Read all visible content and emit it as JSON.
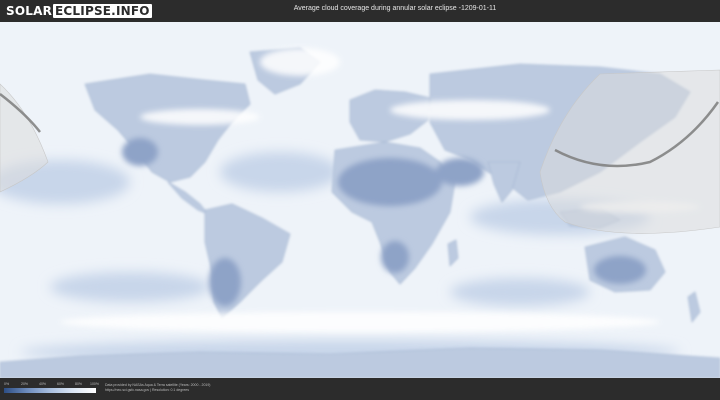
{
  "header": {
    "logo_part1": "SOLAR",
    "logo_part2": "ECLIPSE.INFO",
    "title": "Average cloud coverage during annular solar eclipse -1209-01-11"
  },
  "legend": {
    "ticks": [
      "0%",
      "20%",
      "40%",
      "60%",
      "80%",
      "100%"
    ],
    "colors": [
      "#2d4e84",
      "#6d8cbd",
      "#a9bfdf",
      "#dbe6f4",
      "#ffffff"
    ]
  },
  "credits": {
    "line1": "Data provided by NASAs Aqua & Terra satellite (Years: 2000 - 2019)",
    "line2": "https://neo.sci.gsfc.nasa.gov | Resolution: 0.1 degrees"
  },
  "map": {
    "land_color": "#bccae0",
    "cloud_color": "#f3f6fb",
    "eclipse_path_color": "#7c7c7c",
    "visibility_overlay_color": "#dcdcdc"
  }
}
